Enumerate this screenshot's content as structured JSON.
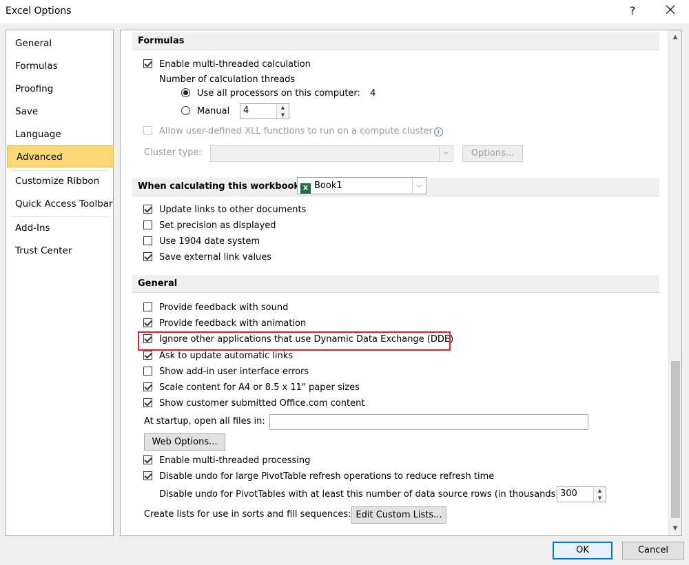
{
  "window": {
    "title": "Excel Options",
    "help_label": "?",
    "close_label": "✕"
  },
  "sidebar": {
    "items": [
      {
        "label": "General"
      },
      {
        "label": "Formulas"
      },
      {
        "label": "Proofing"
      },
      {
        "label": "Save"
      },
      {
        "label": "Language"
      },
      {
        "label": "Advanced",
        "selected": true
      },
      {
        "label": "Customize Ribbon"
      },
      {
        "label": "Quick Access Toolbar"
      },
      {
        "label": "Add-Ins"
      },
      {
        "label": "Trust Center"
      }
    ]
  },
  "formulas": {
    "heading": "Formulas",
    "multithreaded_calc": "Enable multi-threaded calculation",
    "threads_label": "Number of calculation threads",
    "use_all_label": "Use all processors on this computer:",
    "use_all_count": "4",
    "manual_label": "Manual",
    "manual_value": "4",
    "xll_label": "Allow user-defined XLL functions to run on a compute cluster",
    "cluster_type_label": "Cluster type:",
    "options_button": "Options..."
  },
  "workbook": {
    "heading": "When calculating this workbook:",
    "selected_workbook": "Book1",
    "options": [
      {
        "label": "Update links to other documents",
        "checked": true
      },
      {
        "label": "Set precision as displayed",
        "checked": false
      },
      {
        "label": "Use 1904 date system",
        "checked": false
      },
      {
        "label": "Save external link values",
        "checked": true
      }
    ]
  },
  "general": {
    "heading": "General",
    "options": [
      {
        "label": "Provide feedback with sound",
        "checked": false
      },
      {
        "label": "Provide feedback with animation",
        "checked": true
      },
      {
        "label": "Ignore other applications that use Dynamic Data Exchange (DDE)",
        "checked": true,
        "highlighted": true
      },
      {
        "label": "Ask to update automatic links",
        "checked": true
      },
      {
        "label": "Show add-in user interface errors",
        "checked": false
      },
      {
        "label": "Scale content for A4 or 8.5 x 11\" paper sizes",
        "checked": true
      },
      {
        "label": "Show customer submitted Office.com content",
        "checked": true
      }
    ],
    "startup_label": "At startup, open all files in:",
    "startup_value": "",
    "web_options_button": "Web Options...",
    "multithreaded_processing": "Enable multi-threaded processing",
    "disable_undo_label": "Disable undo for large PivotTable refresh operations to reduce refresh time",
    "disable_undo_rows_label": "Disable undo for PivotTables with at least this number of data source rows (in thousands):",
    "disable_undo_rows_value": "300",
    "custom_lists_label": "Create lists for use in sorts and fill sequences:",
    "edit_custom_lists_button": "Edit Custom Lists..."
  },
  "footer": {
    "ok_label": "OK",
    "cancel_label": "Cancel"
  },
  "colors": {
    "selected_nav_bg": "#fcd874",
    "highlight_border": "#e0202e",
    "default_button_border": "#0078d7"
  }
}
